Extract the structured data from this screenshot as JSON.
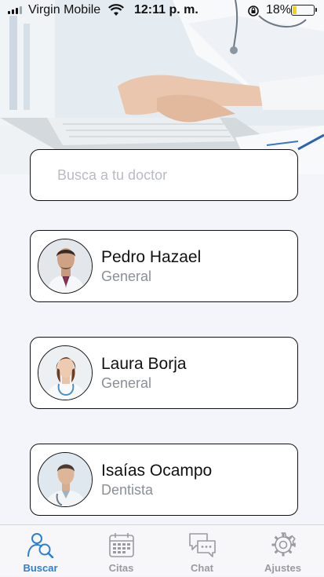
{
  "status_bar": {
    "carrier": "Virgin Mobile",
    "time": "12:11 p. m.",
    "battery": "18%",
    "battery_level": 0.18
  },
  "search": {
    "placeholder": "Busca a tu doctor"
  },
  "doctors": [
    {
      "name": "Pedro Hazael",
      "specialty": "General"
    },
    {
      "name": "Laura Borja",
      "specialty": "General"
    },
    {
      "name": "Isaías Ocampo",
      "specialty": "Dentista"
    }
  ],
  "tabs": [
    {
      "label": "Buscar",
      "icon": "search-doctor-icon",
      "active": true
    },
    {
      "label": "Citas",
      "icon": "calendar-icon",
      "active": false
    },
    {
      "label": "Chat",
      "icon": "chat-bubbles-icon",
      "active": false
    },
    {
      "label": "Ajustes",
      "icon": "gear-icon",
      "active": false
    }
  ],
  "colors": {
    "accent": "#2c7fd1",
    "inactive": "#9a9aa0",
    "battery": "#f2d21b"
  }
}
